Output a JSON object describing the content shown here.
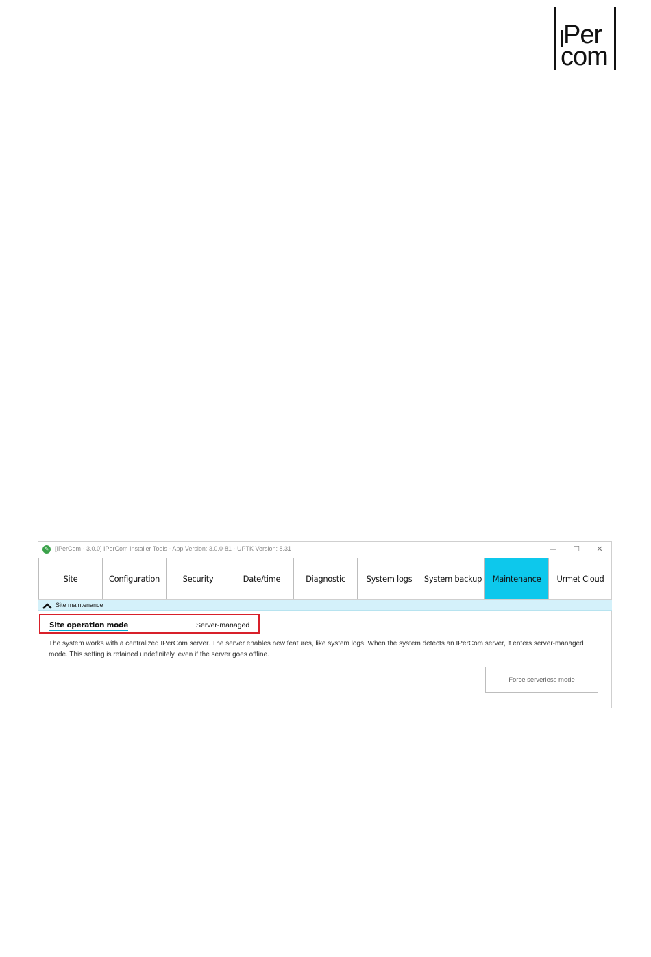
{
  "logo": {
    "line1": "Per",
    "line2": "com"
  },
  "window": {
    "title": "[IPerCom - 3.0.0] IPerCom Installer Tools - App Version: 3.0.0-81 - UPTK Version: 8.31",
    "controls": {
      "minimize": "—",
      "maximize": "☐",
      "close": "✕"
    }
  },
  "tabs": [
    {
      "label": "Site",
      "active": false
    },
    {
      "label": "Configuration",
      "active": false
    },
    {
      "label": "Security",
      "active": false
    },
    {
      "label": "Date/time",
      "active": false
    },
    {
      "label": "Diagnostic",
      "active": false
    },
    {
      "label": "System logs",
      "active": false
    },
    {
      "label": "System backup",
      "active": false
    },
    {
      "label": "Maintenance",
      "active": true
    },
    {
      "label": "Urmet Cloud",
      "active": false
    }
  ],
  "section": {
    "title": "Site maintenance",
    "icon": "chevron-up-icon"
  },
  "operation_mode": {
    "label": "Site operation mode",
    "value": "Server-managed"
  },
  "description": "The system works with a centralized IPerCom server. The server enables new features, like system logs. When the system detects an IPerCom server, it enters server-managed mode. This setting is retained undefinitely, even if the server goes offline.",
  "actions": {
    "force_serverless": "Force serverless mode"
  },
  "colors": {
    "active_tab": "#0dc8ec",
    "section_header": "#d4f1fa",
    "highlight_box": "#d8202a",
    "app_icon": "#3aa24a"
  }
}
